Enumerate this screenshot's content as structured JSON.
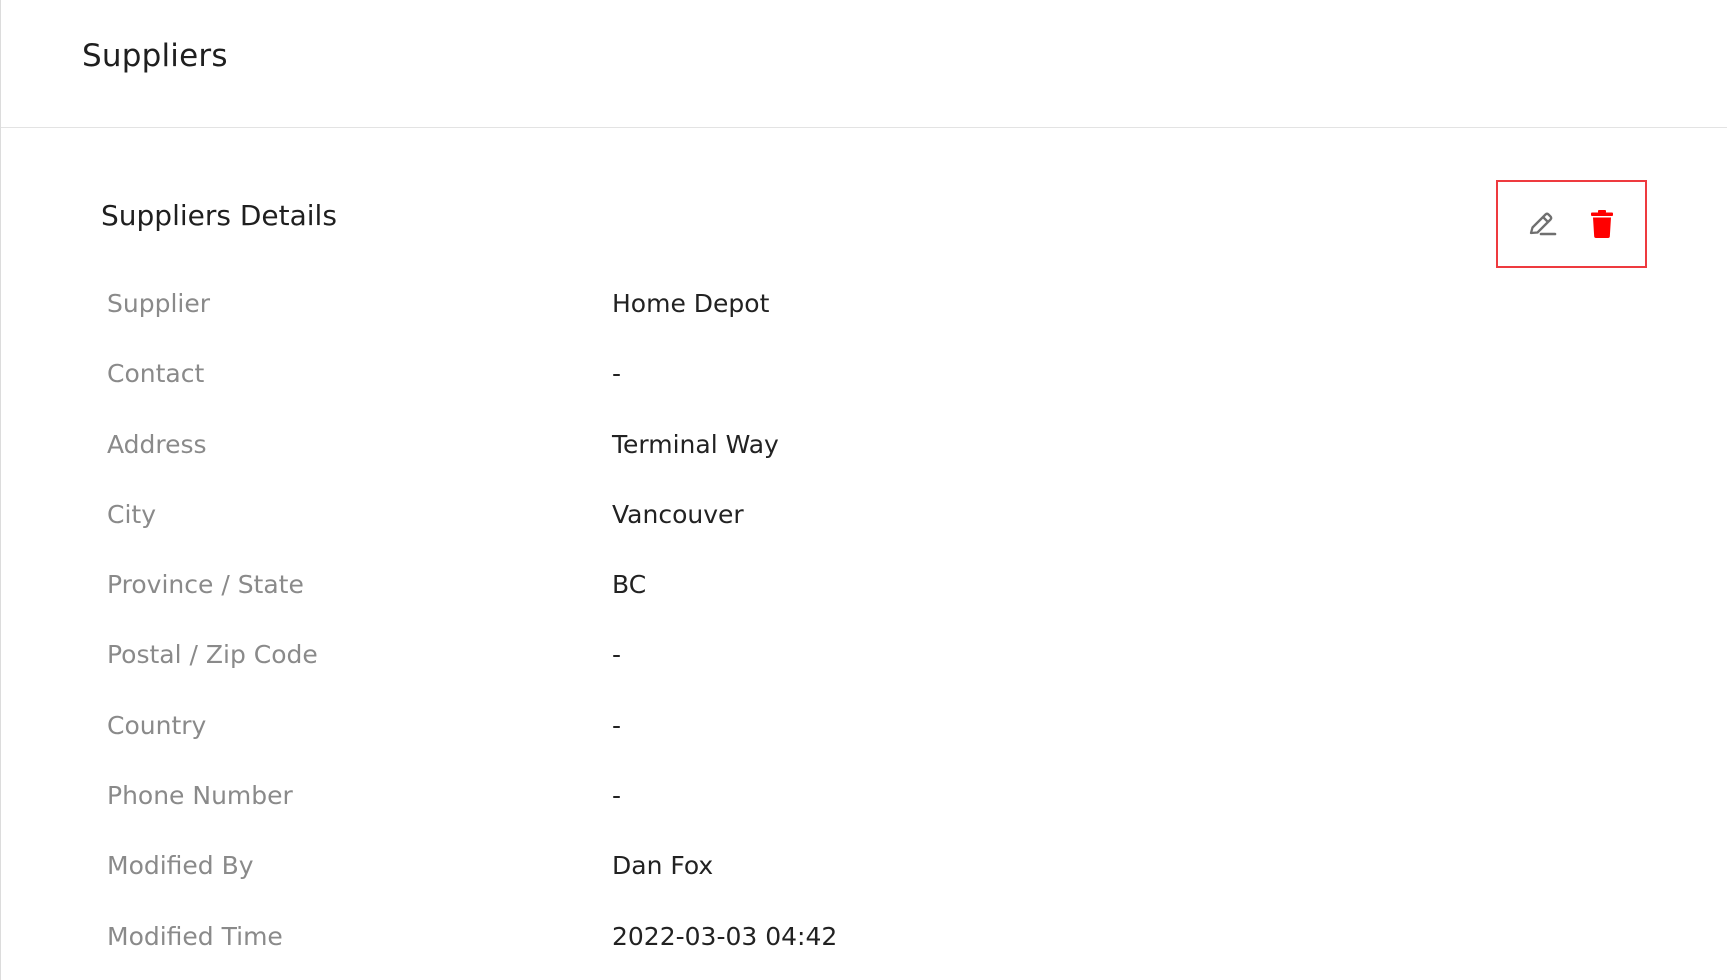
{
  "header": {
    "title": "Suppliers"
  },
  "section": {
    "title": "Suppliers Details"
  },
  "actions": {
    "edit_icon": "edit-pencil-icon",
    "delete_icon": "trash-icon",
    "delete_color": "#ff0000",
    "highlight_color": "#ee3a3f"
  },
  "details": [
    {
      "label": "Supplier",
      "value": "Home Depot"
    },
    {
      "label": "Contact",
      "value": "-"
    },
    {
      "label": "Address",
      "value": "Terminal Way"
    },
    {
      "label": "City",
      "value": "Vancouver"
    },
    {
      "label": "Province / State",
      "value": "BC"
    },
    {
      "label": "Postal / Zip Code",
      "value": "-"
    },
    {
      "label": "Country",
      "value": "-"
    },
    {
      "label": "Phone Number",
      "value": "-"
    },
    {
      "label": "Modified By",
      "value": "Dan Fox"
    },
    {
      "label": "Modified Time",
      "value": "2022-03-03 04:42"
    }
  ]
}
